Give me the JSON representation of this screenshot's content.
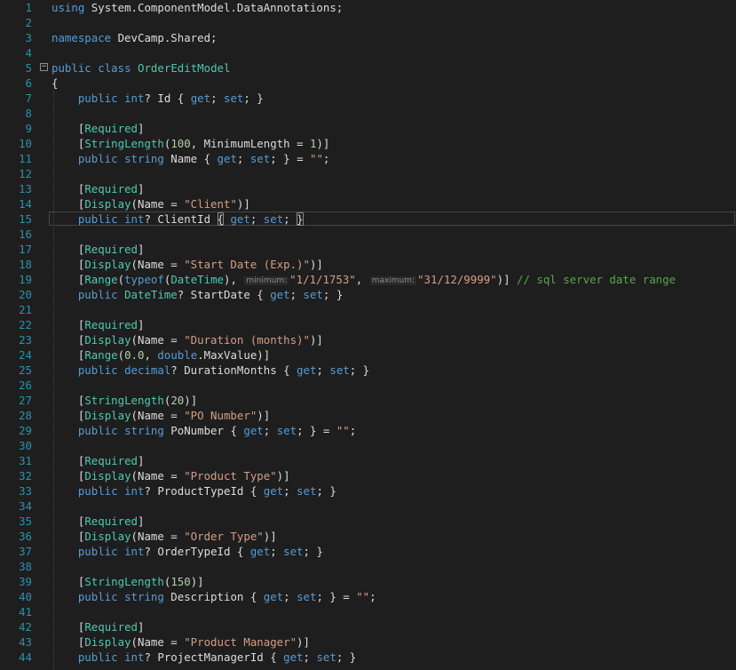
{
  "colors": {
    "background": "#1e1e1e",
    "line_number": "#2b91af",
    "keyword": "#569cd6",
    "type": "#4ec9b0",
    "string": "#d69d85",
    "number": "#b5cea8",
    "comment": "#57a64a",
    "plain": "#dcdcdc"
  },
  "editor": {
    "current_line": 15,
    "fold_marker_line": 5,
    "fold_marker_symbol": "⊟",
    "lines": [
      {
        "n": "1",
        "tokens": [
          [
            "kw",
            "using"
          ],
          [
            "pl",
            " System.ComponentModel.DataAnnotations;"
          ]
        ]
      },
      {
        "n": "2",
        "tokens": []
      },
      {
        "n": "3",
        "tokens": [
          [
            "kw",
            "namespace"
          ],
          [
            "pl",
            " DevCamp.Shared;"
          ]
        ]
      },
      {
        "n": "4",
        "tokens": []
      },
      {
        "n": "5",
        "tokens": [
          [
            "kw",
            "public"
          ],
          [
            "pl",
            " "
          ],
          [
            "kw",
            "class"
          ],
          [
            "pl",
            " "
          ],
          [
            "ty",
            "OrderEditModel"
          ]
        ]
      },
      {
        "n": "6",
        "tokens": [
          [
            "pl",
            "{"
          ]
        ]
      },
      {
        "n": "7",
        "tokens": [
          [
            "pl",
            "    "
          ],
          [
            "kw",
            "public"
          ],
          [
            "pl",
            " "
          ],
          [
            "kw",
            "int"
          ],
          [
            "pl",
            "? Id { "
          ],
          [
            "kw",
            "get"
          ],
          [
            "pl",
            "; "
          ],
          [
            "kw",
            "set"
          ],
          [
            "pl",
            "; }"
          ]
        ]
      },
      {
        "n": "8",
        "tokens": []
      },
      {
        "n": "9",
        "tokens": [
          [
            "pl",
            "    ["
          ],
          [
            "ty",
            "Required"
          ],
          [
            "pl",
            "]"
          ]
        ]
      },
      {
        "n": "10",
        "tokens": [
          [
            "pl",
            "    ["
          ],
          [
            "ty",
            "StringLength"
          ],
          [
            "pl",
            "("
          ],
          [
            "nu",
            "100"
          ],
          [
            "pl",
            ", MinimumLength = "
          ],
          [
            "nu",
            "1"
          ],
          [
            "pl",
            ")]"
          ]
        ]
      },
      {
        "n": "11",
        "tokens": [
          [
            "pl",
            "    "
          ],
          [
            "kw",
            "public"
          ],
          [
            "pl",
            " "
          ],
          [
            "kw",
            "string"
          ],
          [
            "pl",
            " Name { "
          ],
          [
            "kw",
            "get"
          ],
          [
            "pl",
            "; "
          ],
          [
            "kw",
            "set"
          ],
          [
            "pl",
            "; } = "
          ],
          [
            "st",
            "\"\""
          ],
          [
            "pl",
            ";"
          ]
        ]
      },
      {
        "n": "12",
        "tokens": []
      },
      {
        "n": "13",
        "tokens": [
          [
            "pl",
            "    ["
          ],
          [
            "ty",
            "Required"
          ],
          [
            "pl",
            "]"
          ]
        ]
      },
      {
        "n": "14",
        "tokens": [
          [
            "pl",
            "    ["
          ],
          [
            "ty",
            "Display"
          ],
          [
            "pl",
            "(Name = "
          ],
          [
            "st",
            "\"Client\""
          ],
          [
            "pl",
            ")]"
          ]
        ]
      },
      {
        "n": "15",
        "tokens": [
          [
            "pl",
            "    "
          ],
          [
            "kw",
            "public"
          ],
          [
            "pl",
            " "
          ],
          [
            "kw",
            "int"
          ],
          [
            "pl",
            "? ClientId "
          ],
          [
            "bm",
            "{"
          ],
          [
            "pl",
            " "
          ],
          [
            "kw",
            "get"
          ],
          [
            "pl",
            "; "
          ],
          [
            "kw",
            "set"
          ],
          [
            "pl",
            "; "
          ],
          [
            "bm",
            "}"
          ]
        ]
      },
      {
        "n": "16",
        "tokens": []
      },
      {
        "n": "17",
        "tokens": [
          [
            "pl",
            "    ["
          ],
          [
            "ty",
            "Required"
          ],
          [
            "pl",
            "]"
          ]
        ]
      },
      {
        "n": "18",
        "tokens": [
          [
            "pl",
            "    ["
          ],
          [
            "ty",
            "Display"
          ],
          [
            "pl",
            "(Name = "
          ],
          [
            "st",
            "\"Start Date (Exp.)\""
          ],
          [
            "pl",
            ")]"
          ]
        ]
      },
      {
        "n": "19",
        "tokens": [
          [
            "pl",
            "    ["
          ],
          [
            "ty",
            "Range"
          ],
          [
            "pl",
            "("
          ],
          [
            "kw",
            "typeof"
          ],
          [
            "pl",
            "("
          ],
          [
            "ty",
            "DateTime"
          ],
          [
            "pl",
            "), "
          ],
          [
            "hint",
            "minimum:"
          ],
          [
            "st",
            "\"1/1/1753\""
          ],
          [
            "pl",
            ", "
          ],
          [
            "hint",
            "maximum:"
          ],
          [
            "st",
            "\"31/12/9999\""
          ],
          [
            "pl",
            ")] "
          ],
          [
            "cm",
            "// sql server date range"
          ]
        ]
      },
      {
        "n": "20",
        "tokens": [
          [
            "pl",
            "    "
          ],
          [
            "kw",
            "public"
          ],
          [
            "pl",
            " "
          ],
          [
            "ty",
            "DateTime"
          ],
          [
            "pl",
            "? StartDate { "
          ],
          [
            "kw",
            "get"
          ],
          [
            "pl",
            "; "
          ],
          [
            "kw",
            "set"
          ],
          [
            "pl",
            "; }"
          ]
        ]
      },
      {
        "n": "21",
        "tokens": []
      },
      {
        "n": "22",
        "tokens": [
          [
            "pl",
            "    ["
          ],
          [
            "ty",
            "Required"
          ],
          [
            "pl",
            "]"
          ]
        ]
      },
      {
        "n": "23",
        "tokens": [
          [
            "pl",
            "    ["
          ],
          [
            "ty",
            "Display"
          ],
          [
            "pl",
            "(Name = "
          ],
          [
            "st",
            "\"Duration (months)\""
          ],
          [
            "pl",
            ")]"
          ]
        ]
      },
      {
        "n": "24",
        "tokens": [
          [
            "pl",
            "    ["
          ],
          [
            "ty",
            "Range"
          ],
          [
            "pl",
            "("
          ],
          [
            "nu",
            "0.0"
          ],
          [
            "pl",
            ", "
          ],
          [
            "kw",
            "double"
          ],
          [
            "pl",
            ".MaxValue)]"
          ]
        ]
      },
      {
        "n": "25",
        "tokens": [
          [
            "pl",
            "    "
          ],
          [
            "kw",
            "public"
          ],
          [
            "pl",
            " "
          ],
          [
            "kw",
            "decimal"
          ],
          [
            "pl",
            "? DurationMonths { "
          ],
          [
            "kw",
            "get"
          ],
          [
            "pl",
            "; "
          ],
          [
            "kw",
            "set"
          ],
          [
            "pl",
            "; }"
          ]
        ]
      },
      {
        "n": "26",
        "tokens": []
      },
      {
        "n": "27",
        "tokens": [
          [
            "pl",
            "    ["
          ],
          [
            "ty",
            "StringLength"
          ],
          [
            "pl",
            "("
          ],
          [
            "nu",
            "20"
          ],
          [
            "pl",
            ")]"
          ]
        ]
      },
      {
        "n": "28",
        "tokens": [
          [
            "pl",
            "    ["
          ],
          [
            "ty",
            "Display"
          ],
          [
            "pl",
            "(Name = "
          ],
          [
            "st",
            "\"PO Number\""
          ],
          [
            "pl",
            ")]"
          ]
        ]
      },
      {
        "n": "29",
        "tokens": [
          [
            "pl",
            "    "
          ],
          [
            "kw",
            "public"
          ],
          [
            "pl",
            " "
          ],
          [
            "kw",
            "string"
          ],
          [
            "pl",
            " PoNumber { "
          ],
          [
            "kw",
            "get"
          ],
          [
            "pl",
            "; "
          ],
          [
            "kw",
            "set"
          ],
          [
            "pl",
            "; } = "
          ],
          [
            "st",
            "\"\""
          ],
          [
            "pl",
            ";"
          ]
        ]
      },
      {
        "n": "30",
        "tokens": []
      },
      {
        "n": "31",
        "tokens": [
          [
            "pl",
            "    ["
          ],
          [
            "ty",
            "Required"
          ],
          [
            "pl",
            "]"
          ]
        ]
      },
      {
        "n": "32",
        "tokens": [
          [
            "pl",
            "    ["
          ],
          [
            "ty",
            "Display"
          ],
          [
            "pl",
            "(Name = "
          ],
          [
            "st",
            "\"Product Type\""
          ],
          [
            "pl",
            ")]"
          ]
        ]
      },
      {
        "n": "33",
        "tokens": [
          [
            "pl",
            "    "
          ],
          [
            "kw",
            "public"
          ],
          [
            "pl",
            " "
          ],
          [
            "kw",
            "int"
          ],
          [
            "pl",
            "? ProductTypeId { "
          ],
          [
            "kw",
            "get"
          ],
          [
            "pl",
            "; "
          ],
          [
            "kw",
            "set"
          ],
          [
            "pl",
            "; }"
          ]
        ]
      },
      {
        "n": "34",
        "tokens": []
      },
      {
        "n": "35",
        "tokens": [
          [
            "pl",
            "    ["
          ],
          [
            "ty",
            "Required"
          ],
          [
            "pl",
            "]"
          ]
        ]
      },
      {
        "n": "36",
        "tokens": [
          [
            "pl",
            "    ["
          ],
          [
            "ty",
            "Display"
          ],
          [
            "pl",
            "(Name = "
          ],
          [
            "st",
            "\"Order Type\""
          ],
          [
            "pl",
            ")]"
          ]
        ]
      },
      {
        "n": "37",
        "tokens": [
          [
            "pl",
            "    "
          ],
          [
            "kw",
            "public"
          ],
          [
            "pl",
            " "
          ],
          [
            "kw",
            "int"
          ],
          [
            "pl",
            "? OrderTypeId { "
          ],
          [
            "kw",
            "get"
          ],
          [
            "pl",
            "; "
          ],
          [
            "kw",
            "set"
          ],
          [
            "pl",
            "; }"
          ]
        ]
      },
      {
        "n": "38",
        "tokens": []
      },
      {
        "n": "39",
        "tokens": [
          [
            "pl",
            "    ["
          ],
          [
            "ty",
            "StringLength"
          ],
          [
            "pl",
            "("
          ],
          [
            "nu",
            "150"
          ],
          [
            "pl",
            ")]"
          ]
        ]
      },
      {
        "n": "40",
        "tokens": [
          [
            "pl",
            "    "
          ],
          [
            "kw",
            "public"
          ],
          [
            "pl",
            " "
          ],
          [
            "kw",
            "string"
          ],
          [
            "pl",
            " Description { "
          ],
          [
            "kw",
            "get"
          ],
          [
            "pl",
            "; "
          ],
          [
            "kw",
            "set"
          ],
          [
            "pl",
            "; } = "
          ],
          [
            "st",
            "\"\""
          ],
          [
            "pl",
            ";"
          ]
        ]
      },
      {
        "n": "41",
        "tokens": []
      },
      {
        "n": "42",
        "tokens": [
          [
            "pl",
            "    ["
          ],
          [
            "ty",
            "Required"
          ],
          [
            "pl",
            "]"
          ]
        ]
      },
      {
        "n": "43",
        "tokens": [
          [
            "pl",
            "    ["
          ],
          [
            "ty",
            "Display"
          ],
          [
            "pl",
            "(Name = "
          ],
          [
            "st",
            "\"Product Manager\""
          ],
          [
            "pl",
            ")]"
          ]
        ]
      },
      {
        "n": "44",
        "tokens": [
          [
            "pl",
            "    "
          ],
          [
            "kw",
            "public"
          ],
          [
            "pl",
            " "
          ],
          [
            "kw",
            "int"
          ],
          [
            "pl",
            "? ProjectManagerId { "
          ],
          [
            "kw",
            "get"
          ],
          [
            "pl",
            "; "
          ],
          [
            "kw",
            "set"
          ],
          [
            "pl",
            "; }"
          ]
        ]
      }
    ]
  }
}
